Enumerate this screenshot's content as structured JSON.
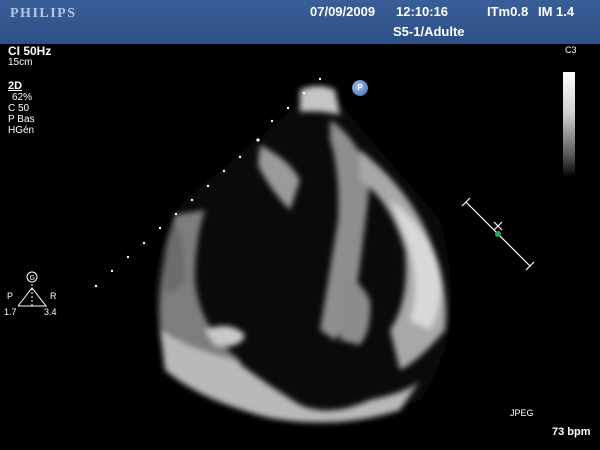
{
  "header": {
    "brand": "PHILIPS",
    "date": "07/09/2009",
    "time": "12:10:16",
    "itm": "ITm0.8",
    "im": "IM 1.4",
    "probe_preset": "S5-1/Adulte"
  },
  "imaging_params": {
    "ci": "CI 50Hz",
    "depth": "15cm",
    "mode": "2D",
    "gain_pct": "62%",
    "compression": "C 50",
    "power": "P Bas",
    "harmonic": "HGén"
  },
  "scale": {
    "label": "C3"
  },
  "orientation": {
    "left": "P",
    "right": "R",
    "left_val": "1.7",
    "right_val": "3.4",
    "marker": "G"
  },
  "marker_p": "P",
  "footer": {
    "format": "JPEG",
    "heart_rate": "73 bpm"
  },
  "colors": {
    "header_bg": "#2f5189",
    "brand": "#b4c6e6",
    "caliper_dot": "#2ea84f"
  }
}
